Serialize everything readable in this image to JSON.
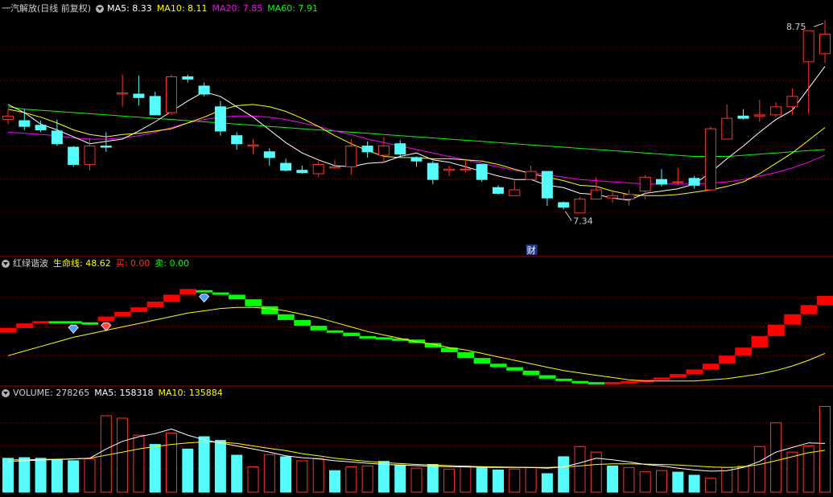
{
  "colors": {
    "up": "#ff3232",
    "down": "#54fcfc",
    "ma5": "#ffffff",
    "ma10": "#ffff00",
    "ma20": "#ff00ff",
    "ma60": "#00ff00",
    "grid": "#8b0000",
    "red": "#ff0000",
    "green": "#00ff00",
    "life": "#ffff00"
  },
  "price_panel": {
    "title": "一汽解放(日线 前复权)",
    "ma5_label": "MA5: 8.33",
    "ma10_label": "MA10: 8.11",
    "ma20_label": "MA20: 7.85",
    "ma60_label": "MA60: 7.91",
    "high_label": "8.75",
    "low_label": "7.34",
    "event_badge": "财",
    "toggle_icon": "chevron-down-icon"
  },
  "indicator_panel": {
    "title": "红绿谐波",
    "life_label": "生命线: 48.62",
    "buy_label": "买: 0.00",
    "sell_label": "卖: 0.00",
    "marker_icons": [
      "diamond-blue-icon",
      "diamond-red-icon",
      "diamond-blue-icon"
    ]
  },
  "volume_panel": {
    "title": "VOLUME: 278265",
    "ma5_label": "MA5: 158318",
    "ma10_label": "MA10: 135884"
  },
  "chart_data": {
    "type": "candlestick",
    "price_range": [
      7.0,
      9.0
    ],
    "candles": [
      [
        8.09,
        8.12,
        8.18,
        8.05
      ],
      [
        8.08,
        8.03,
        8.18,
        8.0
      ],
      [
        8.04,
        8.0,
        8.08,
        7.98
      ],
      [
        7.99,
        7.88,
        8.09,
        7.86
      ],
      [
        7.85,
        7.7,
        7.86,
        7.68
      ],
      [
        7.7,
        7.86,
        7.93,
        7.65
      ],
      [
        7.86,
        7.85,
        7.98,
        7.81
      ],
      [
        8.31,
        8.32,
        8.48,
        8.2
      ],
      [
        8.31,
        8.28,
        8.47,
        8.21
      ],
      [
        8.29,
        8.13,
        8.33,
        8.13
      ],
      [
        8.15,
        8.46,
        8.48,
        8.13
      ],
      [
        8.46,
        8.44,
        8.48,
        8.41
      ],
      [
        8.38,
        8.31,
        8.41,
        8.29
      ],
      [
        8.2,
        7.99,
        8.25,
        7.95
      ],
      [
        7.95,
        7.88,
        7.98,
        7.83
      ],
      [
        7.86,
        7.87,
        7.92,
        7.79
      ],
      [
        7.81,
        7.76,
        7.84,
        7.69
      ],
      [
        7.71,
        7.65,
        7.75,
        7.64
      ],
      [
        7.65,
        7.63,
        7.69,
        7.62
      ],
      [
        7.62,
        7.7,
        7.73,
        7.59
      ],
      [
        7.67,
        7.68,
        7.74,
        7.66
      ],
      [
        7.68,
        7.86,
        7.92,
        7.61
      ],
      [
        7.86,
        7.81,
        7.9,
        7.76
      ],
      [
        7.78,
        7.86,
        7.94,
        7.72
      ],
      [
        7.88,
        7.79,
        7.91,
        7.77
      ],
      [
        7.76,
        7.73,
        7.77,
        7.68
      ],
      [
        7.71,
        7.57,
        7.73,
        7.53
      ],
      [
        7.65,
        7.66,
        7.69,
        7.6
      ],
      [
        7.66,
        7.66,
        7.74,
        7.63
      ],
      [
        7.7,
        7.57,
        7.7,
        7.55
      ],
      [
        7.5,
        7.45,
        7.52,
        7.44
      ],
      [
        7.43,
        7.48,
        7.56,
        7.43
      ],
      [
        7.57,
        7.64,
        7.69,
        7.57
      ],
      [
        7.64,
        7.41,
        7.64,
        7.34
      ],
      [
        7.37,
        7.33,
        7.38,
        7.31
      ],
      [
        7.28,
        7.4,
        7.42,
        7.33
      ],
      [
        7.4,
        7.48,
        7.59,
        7.4
      ],
      [
        7.41,
        7.43,
        7.47,
        7.37
      ],
      [
        7.4,
        7.44,
        7.48,
        7.34
      ],
      [
        7.47,
        7.59,
        7.61,
        7.4
      ],
      [
        7.57,
        7.53,
        7.66,
        7.51
      ],
      [
        7.55,
        7.55,
        7.67,
        7.52
      ],
      [
        7.58,
        7.52,
        7.6,
        7.49
      ],
      [
        7.48,
        8.01,
        8.03,
        7.48
      ],
      [
        7.92,
        8.1,
        8.22,
        7.92
      ],
      [
        8.12,
        8.1,
        8.18,
        8.09
      ],
      [
        8.12,
        8.13,
        8.26,
        8.07
      ],
      [
        8.13,
        8.2,
        8.24,
        8.11
      ],
      [
        8.2,
        8.29,
        8.36,
        8.13
      ],
      [
        8.59,
        8.86,
        8.66,
        8.14
      ],
      [
        8.66,
        8.83,
        8.95,
        8.58
      ]
    ],
    "ma5": [
      8.22,
      8.15,
      8.05,
      8.0,
      7.94,
      7.88,
      7.9,
      7.92,
      7.99,
      8.07,
      8.16,
      8.25,
      8.33,
      8.29,
      8.2,
      8.11,
      8.0,
      7.89,
      7.8,
      7.74,
      7.69,
      7.68,
      7.71,
      7.72,
      7.77,
      7.8,
      7.74,
      7.72,
      7.68,
      7.64,
      7.6,
      7.57,
      7.57,
      7.52,
      7.5,
      7.45,
      7.44,
      7.41,
      7.39,
      7.45,
      7.47,
      7.49,
      7.53,
      7.63,
      7.75,
      7.86,
      7.98,
      8.09,
      8.17,
      8.36,
      8.55
    ],
    "ma10": [
      8.18,
      8.15,
      8.11,
      8.06,
      8.0,
      7.96,
      7.94,
      7.96,
      7.97,
      7.99,
      8.01,
      8.06,
      8.11,
      8.17,
      8.21,
      8.22,
      8.2,
      8.16,
      8.1,
      8.03,
      7.95,
      7.88,
      7.82,
      7.77,
      7.76,
      7.76,
      7.75,
      7.75,
      7.74,
      7.73,
      7.7,
      7.66,
      7.62,
      7.59,
      7.56,
      7.52,
      7.51,
      7.47,
      7.44,
      7.43,
      7.43,
      7.44,
      7.46,
      7.48,
      7.51,
      7.55,
      7.62,
      7.71,
      7.8,
      7.91,
      8.02
    ],
    "ma20": [
      7.98,
      7.97,
      7.96,
      7.95,
      7.93,
      7.92,
      7.92,
      7.93,
      7.95,
      7.98,
      8.02,
      8.06,
      8.09,
      8.11,
      8.12,
      8.12,
      8.11,
      8.09,
      8.06,
      8.03,
      7.99,
      7.96,
      7.92,
      7.89,
      7.86,
      7.83,
      7.8,
      7.77,
      7.74,
      7.71,
      7.68,
      7.65,
      7.63,
      7.61,
      7.59,
      7.57,
      7.56,
      7.55,
      7.54,
      7.53,
      7.53,
      7.53,
      7.53,
      7.54,
      7.55,
      7.57,
      7.6,
      7.63,
      7.67,
      7.72,
      7.78
    ],
    "ma60": [
      8.2,
      8.18,
      8.17,
      8.16,
      8.15,
      8.14,
      8.13,
      8.12,
      8.11,
      8.1,
      8.09,
      8.08,
      8.07,
      8.06,
      8.05,
      8.04,
      8.03,
      8.02,
      8.01,
      8.0,
      7.99,
      7.98,
      7.97,
      7.96,
      7.95,
      7.94,
      7.93,
      7.92,
      7.91,
      7.9,
      7.89,
      7.88,
      7.87,
      7.86,
      7.85,
      7.84,
      7.83,
      7.82,
      7.81,
      7.8,
      7.79,
      7.78,
      7.77,
      7.77,
      7.77,
      7.78,
      7.79,
      7.8,
      7.81,
      7.82,
      7.83
    ],
    "harmonic": {
      "range": [
        0,
        100
      ],
      "blocks": [
        [
          45,
          49,
          "r"
        ],
        [
          49,
          53,
          "r"
        ],
        [
          53,
          55,
          "r"
        ],
        [
          54,
          55,
          "g"
        ],
        [
          53,
          55,
          "g"
        ],
        [
          53,
          54,
          "g"
        ],
        [
          55,
          59,
          "r"
        ],
        [
          59,
          63,
          "r"
        ],
        [
          63,
          67,
          "r"
        ],
        [
          67,
          72,
          "r"
        ],
        [
          72,
          78,
          "r"
        ],
        [
          78,
          83,
          "r"
        ],
        [
          80,
          82,
          "g"
        ],
        [
          78,
          80,
          "g"
        ],
        [
          74,
          78,
          "g"
        ],
        [
          68,
          74,
          "g"
        ],
        [
          61,
          68,
          "g"
        ],
        [
          56,
          61,
          "g"
        ],
        [
          51,
          56,
          "g"
        ],
        [
          47,
          51,
          "g"
        ],
        [
          45,
          47,
          "g"
        ],
        [
          42,
          45,
          "g"
        ],
        [
          41,
          42,
          "g"
        ],
        [
          40,
          41,
          "g"
        ],
        [
          39,
          40,
          "g"
        ],
        [
          36,
          39,
          "g"
        ],
        [
          32,
          36,
          "g"
        ],
        [
          28,
          32,
          "g"
        ],
        [
          23,
          28,
          "g"
        ],
        [
          18,
          23,
          "g"
        ],
        [
          15,
          18,
          "g"
        ],
        [
          12,
          15,
          "g"
        ],
        [
          8,
          12,
          "g"
        ],
        [
          5,
          8,
          "g"
        ],
        [
          3,
          5,
          "g"
        ],
        [
          2,
          3,
          "g"
        ],
        [
          1,
          2,
          "g"
        ],
        [
          1,
          2,
          "r"
        ],
        [
          1,
          3,
          "r"
        ],
        [
          2,
          4,
          "r"
        ],
        [
          4,
          6,
          "r"
        ],
        [
          6,
          9,
          "r"
        ],
        [
          9,
          13,
          "r"
        ],
        [
          13,
          18,
          "r"
        ],
        [
          18,
          25,
          "r"
        ],
        [
          25,
          32,
          "r"
        ],
        [
          32,
          42,
          "r"
        ],
        [
          42,
          52,
          "r"
        ],
        [
          52,
          61,
          "r"
        ],
        [
          61,
          69,
          "r"
        ],
        [
          69,
          77,
          "r"
        ],
        [
          77,
          86,
          "r"
        ]
      ],
      "life": [
        25,
        29,
        33,
        37,
        41,
        44,
        47,
        50,
        53,
        56,
        59,
        62,
        64,
        66,
        67,
        67,
        66,
        64,
        61,
        58,
        54,
        50,
        46,
        43,
        40,
        37,
        35,
        32,
        30,
        27,
        24,
        21,
        18,
        15,
        12,
        10,
        8,
        6,
        4,
        3,
        3,
        3,
        3,
        4,
        5,
        7,
        9,
        12,
        16,
        21,
        27
      ]
    },
    "volume": {
      "range": [
        0,
        300000
      ],
      "values": [
        110000,
        112000,
        110000,
        105000,
        102000,
        108000,
        248000,
        240000,
        185000,
        155000,
        192000,
        140000,
        180000,
        168000,
        120000,
        82000,
        122000,
        115000,
        102000,
        110000,
        70000,
        82000,
        85000,
        100000,
        88000,
        78000,
        90000,
        75000,
        85000,
        78000,
        72000,
        75000,
        80000,
        60000,
        115000,
        148000,
        130000,
        85000,
        80000,
        66000,
        70000,
        65000,
        55000,
        45000,
        80000,
        85000,
        148000,
        225000,
        130000,
        150000,
        278000
      ],
      "up": [
        0,
        0,
        0,
        0,
        0,
        1,
        1,
        1,
        1,
        0,
        1,
        0,
        0,
        0,
        0,
        1,
        1,
        0,
        1,
        1,
        0,
        1,
        1,
        0,
        0,
        1,
        0,
        1,
        1,
        0,
        0,
        1,
        1,
        0,
        0,
        1,
        1,
        0,
        1,
        1,
        1,
        0,
        0,
        1,
        1,
        1,
        1,
        1,
        1,
        1,
        1
      ],
      "ma5": [
        100000,
        102000,
        104000,
        106000,
        108000,
        110000,
        140000,
        165000,
        180000,
        190000,
        205000,
        185000,
        170000,
        160000,
        150000,
        140000,
        130000,
        118000,
        112000,
        108000,
        102000,
        98000,
        94000,
        90000,
        88000,
        86000,
        84000,
        83000,
        82000,
        81000,
        80000,
        80000,
        80000,
        78000,
        82000,
        95000,
        110000,
        105000,
        98000,
        90000,
        85000,
        78000,
        72000,
        68000,
        70000,
        80000,
        100000,
        130000,
        145000,
        160000,
        158000
      ],
      "ma10": [
        105000,
        105000,
        106000,
        107000,
        108000,
        110000,
        120000,
        130000,
        140000,
        148000,
        155000,
        160000,
        163000,
        162000,
        158000,
        150000,
        142000,
        135000,
        125000,
        118000,
        110000,
        105000,
        100000,
        96000,
        93000,
        90000,
        88000,
        86000,
        84000,
        83000,
        82000,
        81000,
        80000,
        80000,
        82000,
        85000,
        90000,
        92000,
        92000,
        91000,
        90000,
        88000,
        85000,
        82000,
        80000,
        82000,
        90000,
        102000,
        115000,
        128000,
        135884
      ]
    }
  }
}
